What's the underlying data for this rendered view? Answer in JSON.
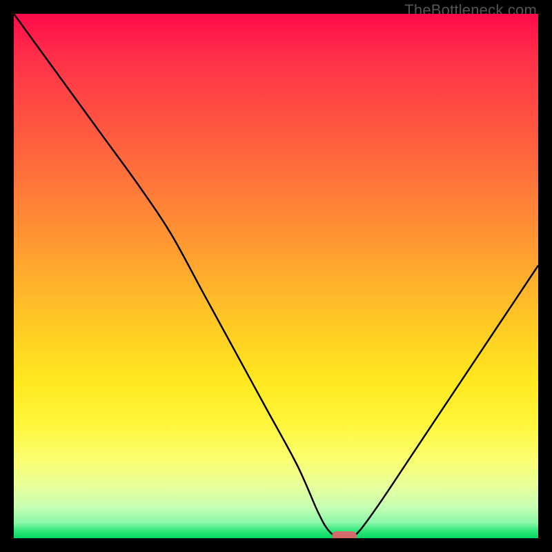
{
  "attribution": "TheBottleneck.com",
  "colors": {
    "gradient_top": "#ff0a4a",
    "gradient_bottom": "#00d765",
    "curve": "#000000",
    "marker": "#d46a6a",
    "frame": "#000000"
  },
  "chart_data": {
    "type": "line",
    "title": "",
    "xlabel": "",
    "ylabel": "",
    "xlim": [
      0,
      100
    ],
    "ylim": [
      0,
      100
    ],
    "grid": false,
    "legend": false,
    "series": [
      {
        "name": "bottleneck-curve",
        "x": [
          0,
          8,
          16,
          24,
          30,
          36,
          42,
          48,
          54,
          58,
          60,
          62,
          64,
          66,
          70,
          76,
          84,
          92,
          100
        ],
        "values": [
          100,
          89,
          78,
          67,
          58,
          47,
          36,
          25,
          14,
          5,
          1.5,
          0,
          0,
          1.5,
          7,
          16,
          28,
          40,
          52
        ]
      }
    ],
    "markers": [
      {
        "name": "optimal-point",
        "x": 63,
        "y": 0,
        "shape": "pill"
      }
    ]
  }
}
